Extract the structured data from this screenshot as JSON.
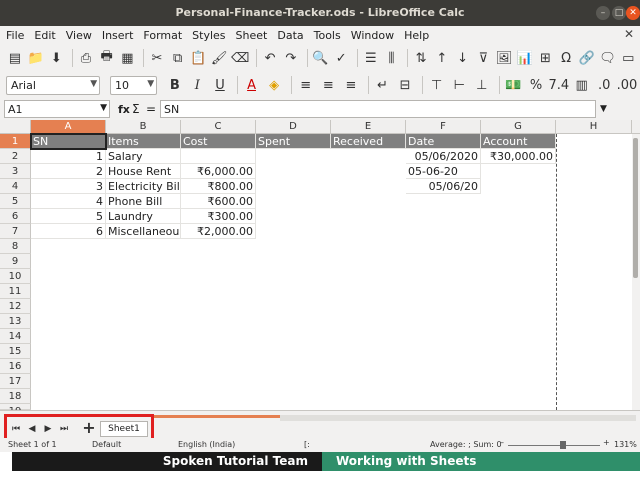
{
  "window": {
    "title": "Personal-Finance-Tracker.ods - LibreOffice Calc"
  },
  "menu": [
    "File",
    "Edit",
    "View",
    "Insert",
    "Format",
    "Styles",
    "Sheet",
    "Data",
    "Tools",
    "Window",
    "Help"
  ],
  "font": {
    "name": "Arial",
    "size": "10"
  },
  "formula": {
    "cell_ref": "A1",
    "fx": "fx",
    "sum": "Σ",
    "equals": "=",
    "content": "SN"
  },
  "columns": [
    "A",
    "B",
    "C",
    "D",
    "E",
    "F",
    "G",
    "H"
  ],
  "rows": [
    "1",
    "2",
    "3",
    "4",
    "5",
    "6",
    "7",
    "8",
    "9",
    "10",
    "11",
    "12",
    "13",
    "14",
    "15",
    "16",
    "17",
    "18",
    "19"
  ],
  "header_row": [
    "SN",
    "Items",
    "Cost",
    "Spent",
    "Received",
    "Date",
    "Account"
  ],
  "data_rows": [
    {
      "sn": "1",
      "item": "Salary",
      "cost": "",
      "date": "05/06/2020",
      "account": "₹30,000.00"
    },
    {
      "sn": "2",
      "item": "House Rent",
      "cost": "₹6,000.00",
      "date": "05-06-20",
      "account": ""
    },
    {
      "sn": "3",
      "item": "Electricity Bill",
      "cost": "₹800.00",
      "date": "05/06/20",
      "account": ""
    },
    {
      "sn": "4",
      "item": "Phone Bill",
      "cost": "₹600.00",
      "date": "",
      "account": ""
    },
    {
      "sn": "5",
      "item": "Laundry",
      "cost": "₹300.00",
      "date": "",
      "account": ""
    },
    {
      "sn": "6",
      "item": "Miscellaneous",
      "cost": "₹2,000.00",
      "date": "",
      "account": ""
    }
  ],
  "sheet_tabs": {
    "active": "Sheet1",
    "add_label": "+"
  },
  "status": {
    "sheet": "Sheet 1 of 1",
    "style": "Default",
    "language": "English (India)",
    "stats": "Average: ; Sum: 0",
    "zoom": "131%"
  },
  "banner": {
    "left": "Spoken Tutorial Team",
    "right": "Working with Sheets"
  },
  "colors": {
    "selected_header": "#e58051",
    "header_row_bg": "#808080",
    "highlight_box": "#e02020",
    "banner_green": "#2f8f6a"
  }
}
